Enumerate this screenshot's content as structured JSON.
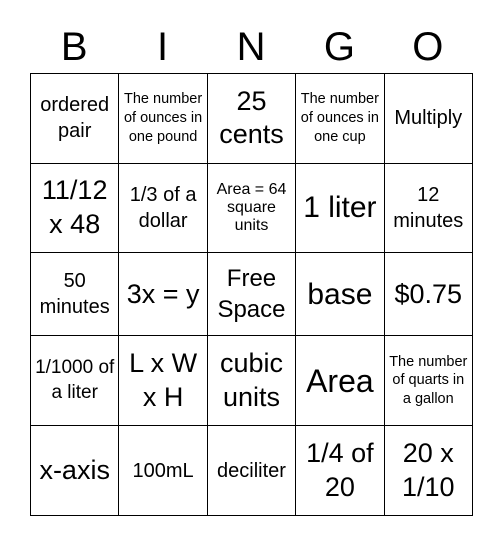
{
  "header": [
    "B",
    "I",
    "N",
    "G",
    "O"
  ],
  "cells": [
    [
      "ordered pair",
      "The number of ounces in one pound",
      "25 cents",
      "The number of ounces in one cup",
      "Multiply"
    ],
    [
      "11/12 x 48",
      "1/3 of a dollar",
      "Area = 64 square units",
      "1 liter",
      "12 minutes"
    ],
    [
      "50 minutes",
      "3x = y",
      "Free Space",
      "base",
      "$0.75"
    ],
    [
      "1/1000 of a liter",
      "L x W x H",
      "cubic units",
      "Area",
      "The number of quarts in a gallon"
    ],
    [
      "x-axis",
      "100mL",
      "deciliter",
      "1/4 of 20",
      "20 x 1/10"
    ]
  ]
}
